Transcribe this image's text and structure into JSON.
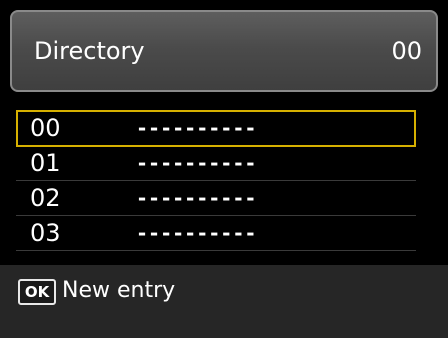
{
  "header": {
    "title": "Directory",
    "value": "00"
  },
  "entries": [
    {
      "number": "00",
      "name": "----------",
      "selected": true
    },
    {
      "number": "01",
      "name": "----------",
      "selected": false
    },
    {
      "number": "02",
      "name": "----------",
      "selected": false
    },
    {
      "number": "03",
      "name": "----------",
      "selected": false
    }
  ],
  "footer": {
    "key_label": "OK",
    "action_label": "New entry"
  },
  "colors": {
    "selection_border": "#d6b000",
    "background": "#000000",
    "footer_background": "#262626"
  }
}
